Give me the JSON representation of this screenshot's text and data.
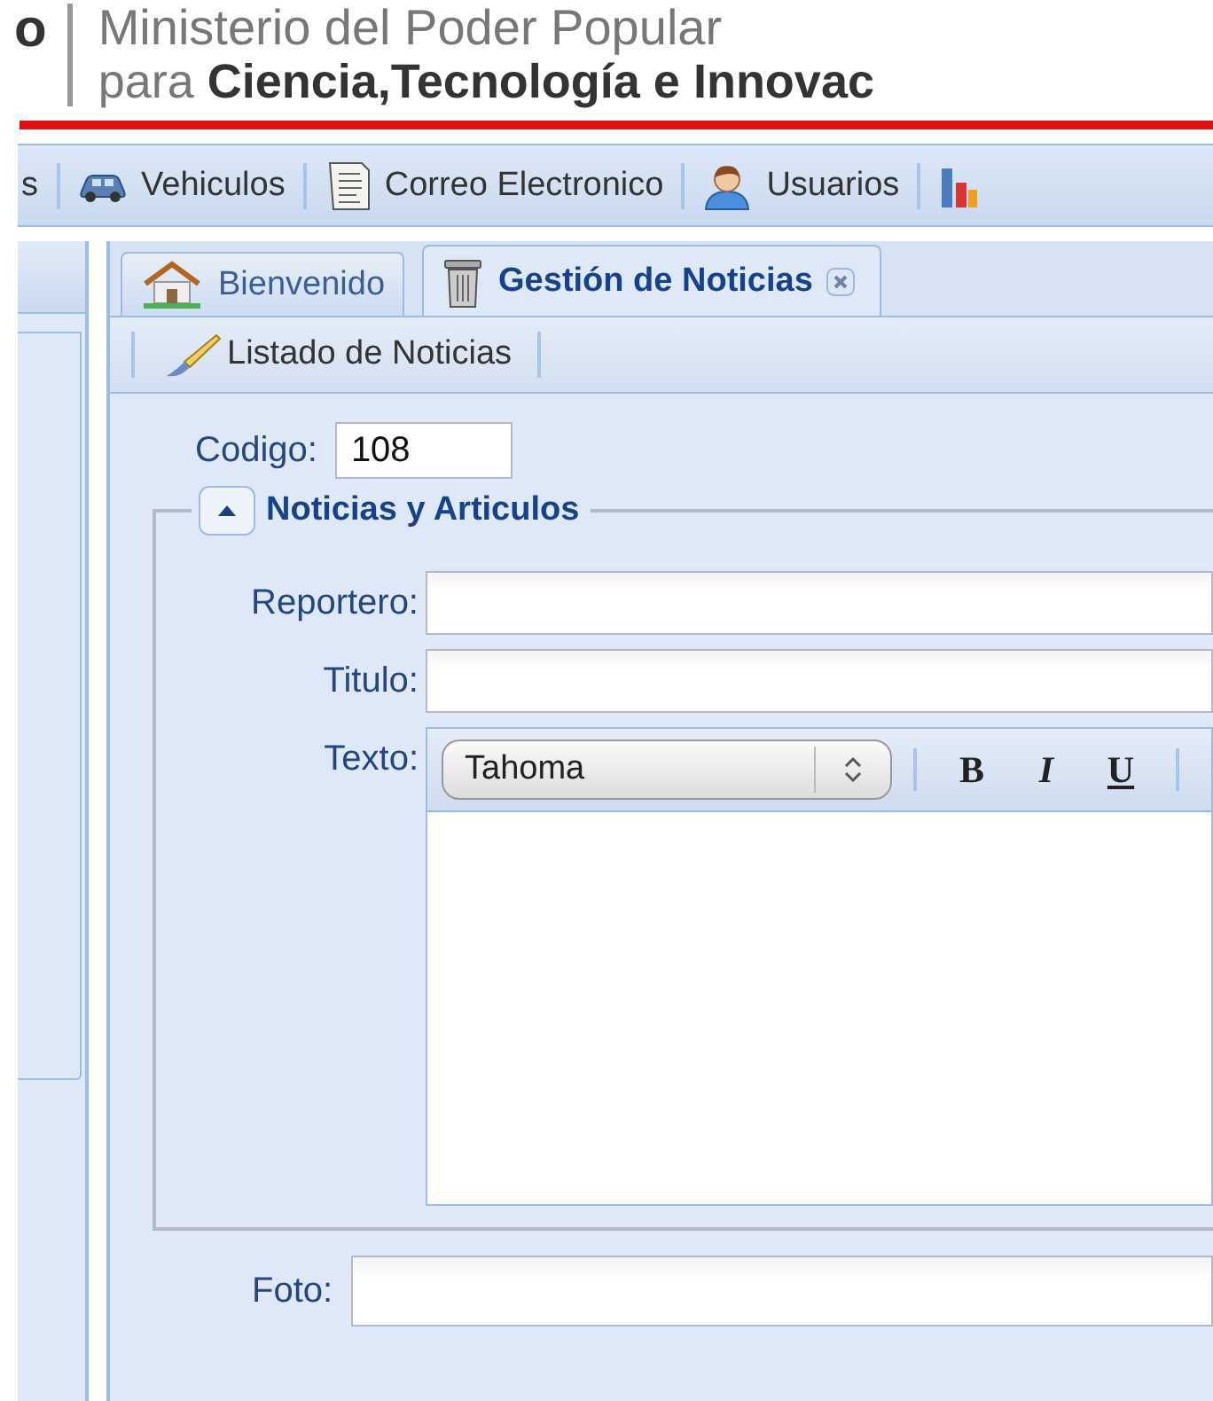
{
  "header": {
    "logo_fragment": "o",
    "line_1": "Ministerio del Poder Popular",
    "line_2": "para **Ciencia,Tecnología e Innovac**"
  },
  "nav": [
    {
      "label": "s",
      "kind": "plain"
    },
    {
      "label": "Vehiculos",
      "kind": "car"
    },
    {
      "label": "Correo Electronico",
      "kind": "document"
    },
    {
      "label": "Usuarios",
      "kind": "user"
    },
    {
      "kind": "chart"
    }
  ],
  "tabs": [
    {
      "label": "Bienvenido",
      "kind": "house",
      "selected": false,
      "closable": false
    },
    {
      "label": "Gestión de Noticias",
      "kind": "trash",
      "selected": true,
      "closable": true
    }
  ],
  "toolbar": [
    {
      "label": "Listado de Noticias",
      "kind": "brush"
    }
  ],
  "codigo": {
    "label": "Codigo:",
    "value": "108"
  },
  "fieldset": {
    "title": "Noticias y Articulos",
    "expanded": true,
    "fields": [
      {
        "kind": "text",
        "label": "Reportero:"
      },
      {
        "kind": "text",
        "label": "Titulo:"
      },
      {
        "kind": "editor",
        "label": "Texto:",
        "font": "Tahoma",
        "buttons": [
          "B",
          "I",
          "U"
        ]
      }
    ]
  },
  "foto": {
    "label": "Foto:"
  }
}
